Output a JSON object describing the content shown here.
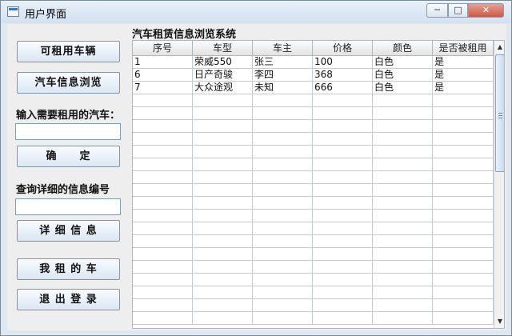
{
  "window": {
    "title": "用户界面",
    "controls": {
      "minimize": "─",
      "maximize": "□",
      "close": "✕"
    }
  },
  "sidebar": {
    "available_button": "可租用车辆",
    "browse_button": "汽车信息浏览",
    "rent_label": "输入需要租用的汽车：",
    "rent_input": {
      "value": "",
      "placeholder": ""
    },
    "confirm_button": "确　　定",
    "query_label": "查询详细的信息编号",
    "query_input": {
      "value": "",
      "placeholder": ""
    },
    "detail_button": "详 细 信 息",
    "my_car_button": "我 租 的 车",
    "logout_button": "退 出 登 录"
  },
  "main": {
    "section_title": "汽车租赁信息浏览系统",
    "table": {
      "headers": [
        "序号",
        "车型",
        "车主",
        "价格",
        "颜色",
        "是否被租用"
      ],
      "rows": [
        [
          "1",
          "荣威550",
          "张三",
          "100",
          "白色",
          "是"
        ],
        [
          "6",
          "日产奇骏",
          "李四",
          "368",
          "白色",
          "是"
        ],
        [
          "7",
          "大众途观",
          "未知",
          "666",
          "白色",
          "是"
        ]
      ]
    }
  },
  "icons": {
    "app": "window-app-icon",
    "scroll_up": "scroll-up-arrow-icon",
    "scroll_down": "scroll-down-arrow-icon",
    "scroll_grip": "scroll-grip-icon"
  }
}
